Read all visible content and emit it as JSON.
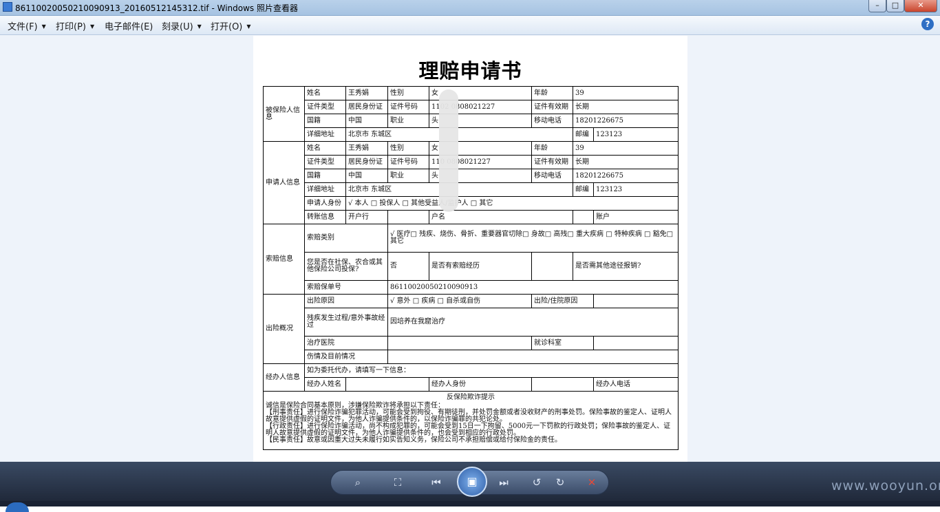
{
  "window": {
    "title": "86110020050210090913_20160512145312.tif - Windows 照片查看器"
  },
  "menu": {
    "file": "文件(F)",
    "print": "打印(P)",
    "email": "电子邮件(E)",
    "burn": "刻录(U)",
    "open": "打开(O)"
  },
  "doc": {
    "title": "理赔申请书",
    "insured": {
      "section": "被保险人信息",
      "name_label": "姓名",
      "name": "王秀娟",
      "gender_label": "性别",
      "gender": "女",
      "age_label": "年龄",
      "age": "39",
      "idtype_label": "证件类型",
      "idtype": "居民身份证",
      "idnum_label": "证件号码",
      "idnum": "1102  0808021227",
      "validity_label": "证件有效期",
      "validity": "长期",
      "nationality_label": "国籍",
      "nationality": "中国",
      "job_label": "职业",
      "job": "头",
      "mobile_label": "移动电话",
      "mobile": "18201226675",
      "address_label": "详细地址",
      "address": "北京市 东城区",
      "zip_label": "邮编",
      "zip": "123123"
    },
    "applicant": {
      "section": "申请人信息",
      "name": "王秀娟",
      "gender": "女",
      "age": "39",
      "idtype": "居民身份证",
      "idnum": "110  0808021227",
      "validity": "长期",
      "nationality": "中国",
      "job": "头",
      "mobile": "18201226675",
      "address": "北京市 东城区",
      "zip": "123123",
      "identity_label": "申请人身份",
      "identity_options": "√ 本人      □ 投保人      □ 其他受益人/监护人      □ 其它",
      "transfer_label": "转账信息",
      "bank_label": "开户行",
      "holder_label": "户名",
      "account_label": "账户"
    },
    "claim": {
      "section": "索赔信息",
      "type_label": "索赔类别",
      "type_options": "√ 医疗□ 残疾、烧伤、骨折、重要器官切除□ 身故□ 高残□ 重大疾病 □ 特种疾病 □ 豁免□ 其它",
      "other_insurance_q": "您是否在社保、农合或其他保险公司投保?",
      "other_insurance_a": "否",
      "history_q": "是否有索赔经历",
      "other_route_q": "是否需其他途径报销?",
      "policy_label": "索赔保单号",
      "policy": "86110020050210090913"
    },
    "incident": {
      "section": "出险概况",
      "cause_label": "出险原因",
      "cause_options": "√ 意外      □ 疾病      □ 自杀或自伤",
      "hospital_reason_label": "出险/住院原因",
      "process_label": "残疾发生过程/意外事故经过",
      "process": "因培养在我窟治疗",
      "hospital_label": "治疗医院",
      "dept_label": "就诊科室",
      "injury_label": "伤情及目前情况"
    },
    "agent": {
      "section": "经办人信息",
      "note": "如为委托代办，请填写一下信息：",
      "name_label": "经办人姓名",
      "identity_label": "经办人身份",
      "phone_label": "经办人电话"
    },
    "notice": {
      "title": "反保险欺诈提示",
      "line1": "诚信是保险合同基本原则，涉嫌保险欺诈将承担以下责任：",
      "line2": "【刑事责任】进行保险诈骗犯罪活动，可能会受到拘役、有期徒刑，并处罚金额或者没收财产的刑事处罚。保险事故的鉴定人、证明人故意提供虚假的证明文件，为他人诈骗提供条件的，以保险诈骗罪的共犯论处。",
      "line3": "【行政责任】进行保险诈骗活动，尚不构成犯罪的，可能会受到15日一下拘留、5000元一下罚款的行政处罚；保险事故的鉴定人、证明人故意提供虚假的证明文件，为他人诈骗提供条件的，也会受到相应的行政处罚。",
      "line4": "【民事责任】故意或因重大过失未履行如实告知义务，保险公司不承担赔偿或给付保险金的责任。"
    }
  },
  "toolbar_icons": [
    "zoom-icon",
    "fit-icon",
    "prev-icon",
    "slideshow-icon",
    "next-icon",
    "rotate-left-icon",
    "rotate-right-icon",
    "delete-icon"
  ],
  "watermark": "www.wooyun.org"
}
